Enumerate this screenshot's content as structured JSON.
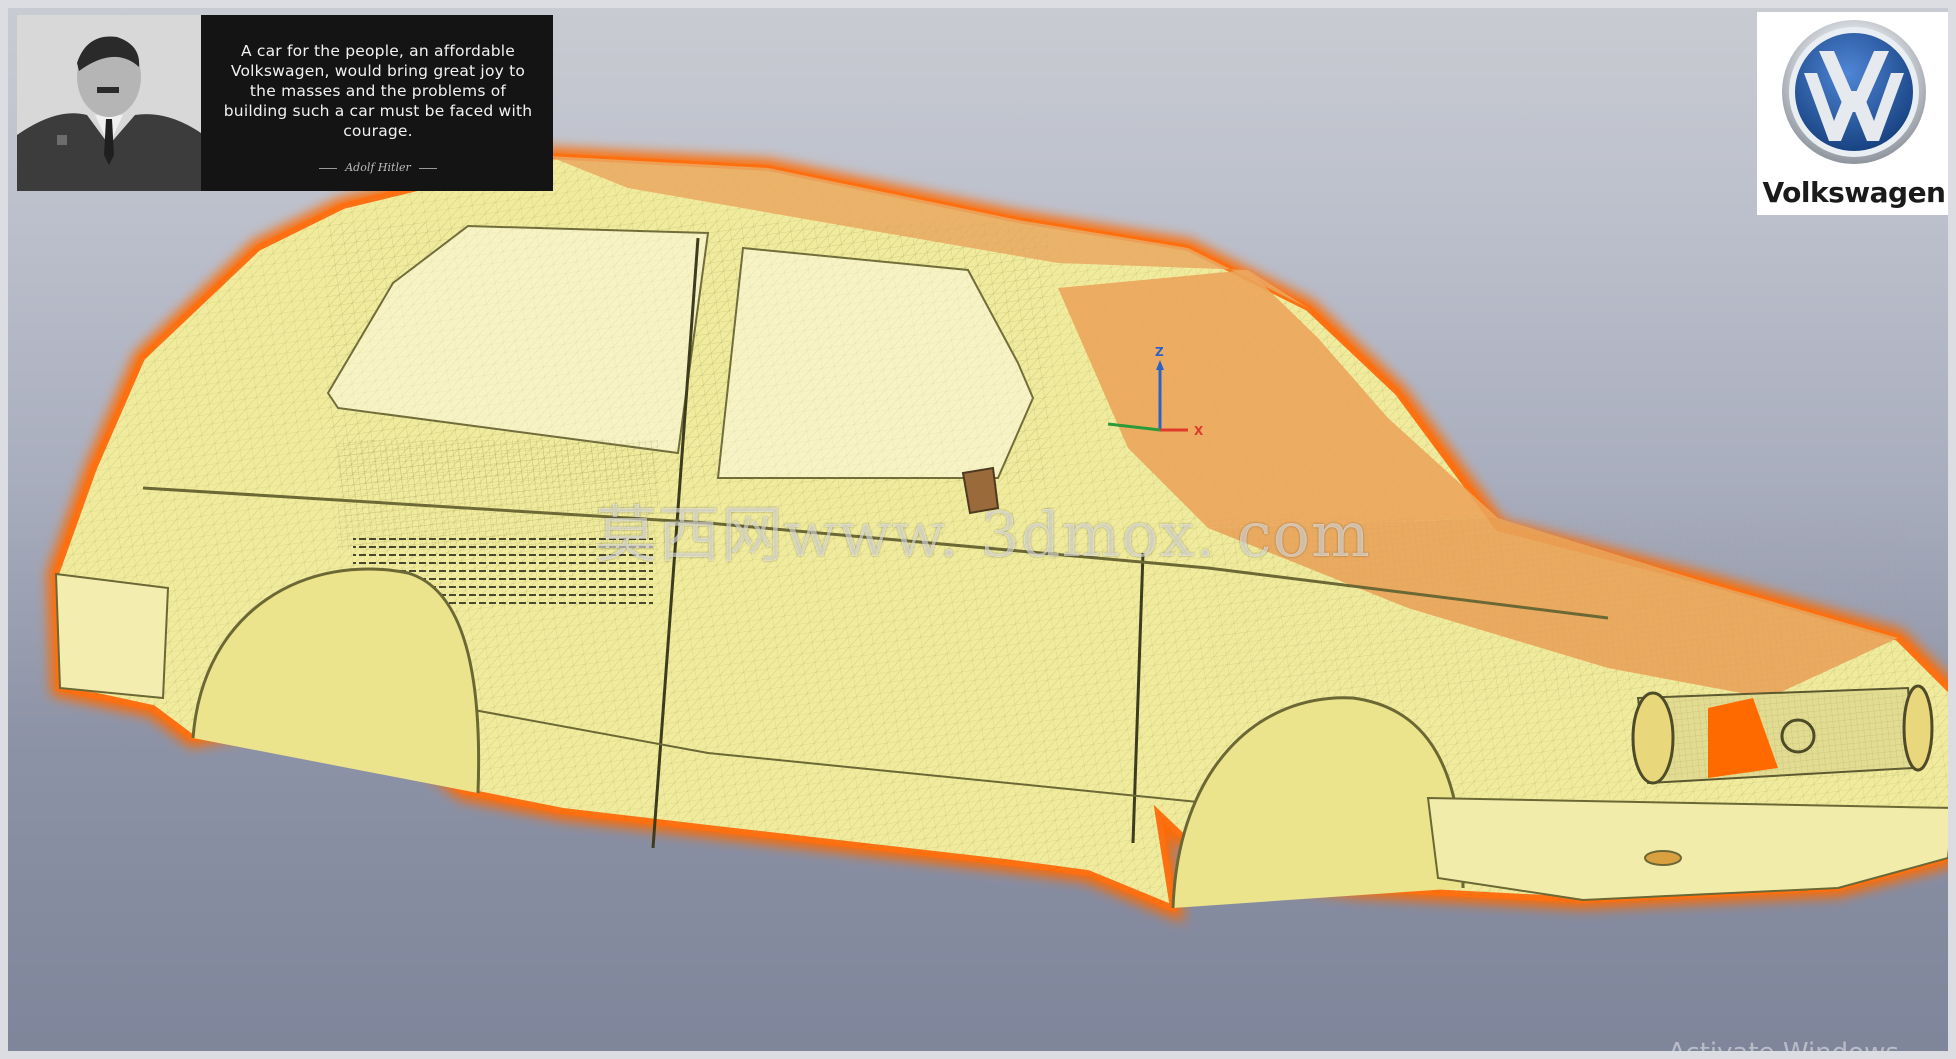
{
  "quote": {
    "text": "A car for the people, an affordable Volkswagen, would bring great joy to the masses and the problems of building such a car must be faced with courage.",
    "author": "Adolf Hitler"
  },
  "brand": {
    "name": "Volkswagen"
  },
  "axes": {
    "z": "Z",
    "x": "X"
  },
  "watermark": "莫西网www. 3dmox. com",
  "system_overlay": "Activate Windows",
  "colors": {
    "mesh_fill": "#f1ec9d",
    "mesh_shade": "#e9a35a",
    "outline_glow": "#ff6a00",
    "vw_blue": "#1f4f99"
  }
}
